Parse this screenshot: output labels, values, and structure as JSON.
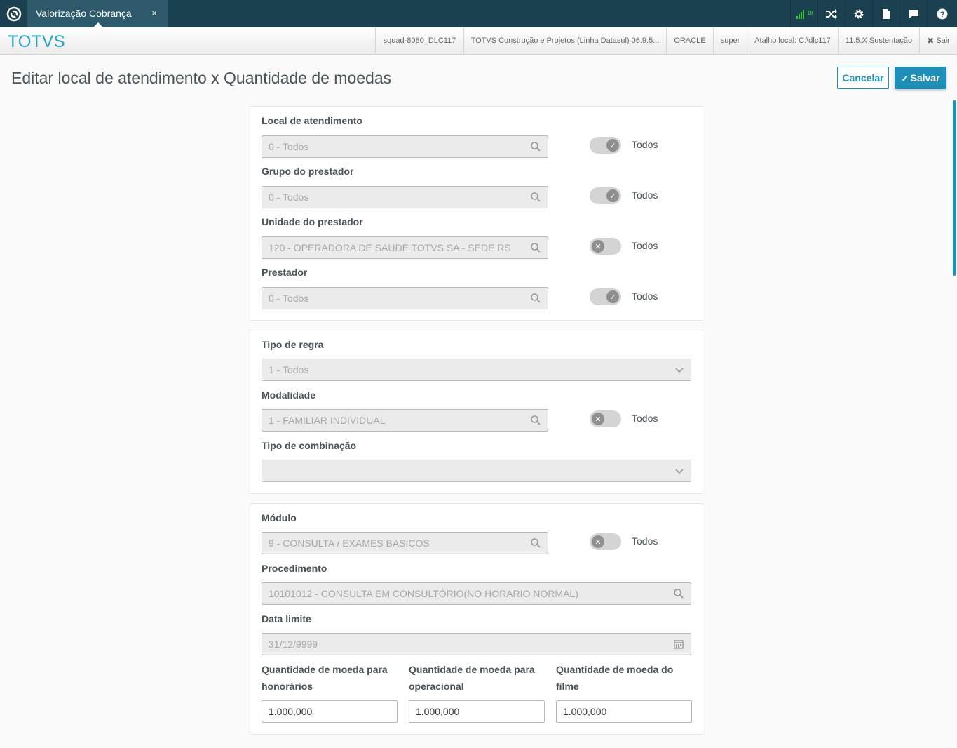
{
  "topbar": {
    "tab_label": "Valorização Cobrança",
    "tab_close": "×",
    "signal_label": "DI",
    "colors": {
      "bg": "#1b4150",
      "tab": "#2d5a6a",
      "signal": "#3cc43c"
    }
  },
  "header": {
    "brand": "TOTVS",
    "info": [
      "squad-8080_DLC117",
      "TOTVS Construção e Projetos (Linha Datasul) 06.9.5...",
      "ORACLE",
      "super",
      "Atalho local: C:\\dlc117",
      "11.5.X Sustentação"
    ],
    "exit_label": "Sair"
  },
  "page": {
    "title": "Editar local de atendimento x Quantidade de moedas",
    "cancel_label": "Cancelar",
    "save_label": "Salvar",
    "accent": "#1e90b7"
  },
  "panel1": {
    "local": {
      "label": "Local de atendimento",
      "value": "0 - Todos",
      "toggle": true,
      "toggle_label": "Todos"
    },
    "grupo": {
      "label": "Grupo do prestador",
      "value": "0 - Todos",
      "toggle": true,
      "toggle_label": "Todos"
    },
    "unidade": {
      "label": "Unidade do prestador",
      "value": "120 - OPERADORA DE SAUDE TOTVS SA - SEDE RS",
      "toggle": false,
      "toggle_label": "Todos"
    },
    "prestador": {
      "label": "Prestador",
      "value": "0 - Todos",
      "toggle": true,
      "toggle_label": "Todos"
    }
  },
  "panel2": {
    "tipo_regra": {
      "label": "Tipo de regra",
      "value": "1 - Todos"
    },
    "modalidade": {
      "label": "Modalidade",
      "value": "1 - FAMILIAR INDIVIDUAL",
      "toggle": false,
      "toggle_label": "Todos"
    },
    "tipo_combinacao": {
      "label": "Tipo de combinação",
      "value": ""
    }
  },
  "panel3": {
    "modulo": {
      "label": "Módulo",
      "value": "9 - CONSULTA / EXAMES BASICOS",
      "toggle": false,
      "toggle_label": "Todos"
    },
    "procedimento": {
      "label": "Procedimento",
      "value": "10101012 - CONSULTA EM CONSULTÓRIO(NO HORARIO NORMAL)"
    },
    "data_limite": {
      "label": "Data limite",
      "value": "31/12/9999"
    },
    "qtd_honorarios": {
      "label_line1": "Quantidade de moeda para",
      "label_line2": "honorários",
      "value": "1.000,000"
    },
    "qtd_operacional": {
      "label_line1": "Quantidade de moeda para",
      "label_line2": "operacional",
      "value": "1.000,000"
    },
    "qtd_filme": {
      "label_line1": "Quantidade de moeda do",
      "label_line2": "filme",
      "value": "1.000,000"
    }
  }
}
